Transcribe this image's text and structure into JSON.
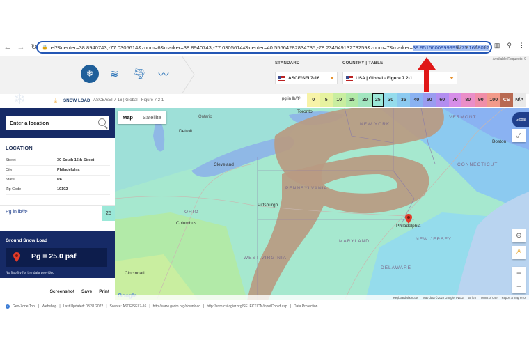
{
  "browser": {
    "url_text": "el?&center=38.8940743,-77.0305614&zoom=6&marker=38.8940743,-77.0305614#&center=40.55664282834735,-78.23464913273259&zoom=7&marker=",
    "url_selected": "39.9515600999999,-75.1658017",
    "back_icon": "back-arrow-icon",
    "forward_icon": "forward-arrow-icon",
    "reload_icon": "reload-icon"
  },
  "header": {
    "available_requests": "Available Requests: 9",
    "standard_label": "STANDARD",
    "standard_value": "ASCE/SEI 7-16",
    "country_label": "COUNTRY | TABLE",
    "country_value": "USA | Global - Figure 7.2-1",
    "tools": [
      "snowflake-icon",
      "wind-icon",
      "tornado-icon",
      "seismic-icon"
    ],
    "accent_color": "#1f5f9a"
  },
  "title_row": {
    "title": "SNOW LOAD",
    "subtitle": "ASCE/SEI 7-16  |  Global - Figure 7.2-1",
    "pg_unit": "pg in lb/ft²"
  },
  "legend": [
    {
      "label": "0",
      "color": "#f7f3a8"
    },
    {
      "label": "5",
      "color": "#e6f2a0"
    },
    {
      "label": "10",
      "color": "#c9eea0"
    },
    {
      "label": "15",
      "color": "#b2eaa8"
    },
    {
      "label": "20",
      "color": "#a2e6c0"
    },
    {
      "label": "25",
      "color": "#9be8d8",
      "current": true
    },
    {
      "label": "30",
      "color": "#95dcec"
    },
    {
      "label": "35",
      "color": "#8ccaf0"
    },
    {
      "label": "40",
      "color": "#8ab2f2"
    },
    {
      "label": "50",
      "color": "#9a9cf0"
    },
    {
      "label": "60",
      "color": "#b28ef0"
    },
    {
      "label": "70",
      "color": "#d68ee8"
    },
    {
      "label": "80",
      "color": "#ea8ec8"
    },
    {
      "label": "90",
      "color": "#f08ea8"
    },
    {
      "label": "100",
      "color": "#f29a8a"
    },
    {
      "label": "CS",
      "color": "#b86a52"
    },
    {
      "label": "N/A",
      "color": "#e9e9e9"
    }
  ],
  "sidebar": {
    "search_placeholder": "Enter a location",
    "location_title": "LOCATION",
    "rows": [
      {
        "key": "Street",
        "value": "30 South 15th Street"
      },
      {
        "key": "City",
        "value": "Philadelphia"
      },
      {
        "key": "State",
        "value": "PA"
      },
      {
        "key": "Zip Code",
        "value": "19102"
      }
    ],
    "pg_label": "Pg in lb/ft²",
    "pg_value": "25",
    "gsl_title": "Ground Snow Load",
    "gsl_value": "Pg = 25.0 psf",
    "gsl_note": "No liability for the data provided",
    "actions": [
      "Screenshot",
      "Save",
      "Print"
    ]
  },
  "map": {
    "tab_map": "Map",
    "tab_satellite": "Satellite",
    "places": [
      {
        "name": "Detroit"
      },
      {
        "name": "Toronto"
      },
      {
        "name": "Ontario"
      },
      {
        "name": "Cleveland"
      },
      {
        "name": "Pittsburgh"
      },
      {
        "name": "Columbus"
      },
      {
        "name": "OHIO"
      },
      {
        "name": "PENNSYLVANIA"
      },
      {
        "name": "NEW YORK"
      },
      {
        "name": "Philadelphia"
      },
      {
        "name": "NEW JERSEY"
      },
      {
        "name": "MARYLAND"
      },
      {
        "name": "WEST VIRGINIA"
      },
      {
        "name": "VERMONT"
      },
      {
        "name": "CONNECTICUT"
      },
      {
        "name": "Boston"
      },
      {
        "name": "DELAWARE"
      },
      {
        "name": "Cincinnati"
      }
    ],
    "footer": [
      "Keyboard shortcuts",
      "Map data ©2022 Google, INEGI",
      "50 km",
      "Terms of Use",
      "Report a map error"
    ],
    "google": "Google",
    "globe_label": "Global"
  },
  "footer": {
    "items": [
      "Geo-Zone Tool",
      "Webshop",
      "Last Updated: 03/31/2022",
      "Source: ASCE/SEI 7-16",
      "http://www.gadm.org/download",
      "http://srtm.csi.cgiar.org/SELECTION/inputCoord.asp",
      "Data Protection"
    ]
  }
}
